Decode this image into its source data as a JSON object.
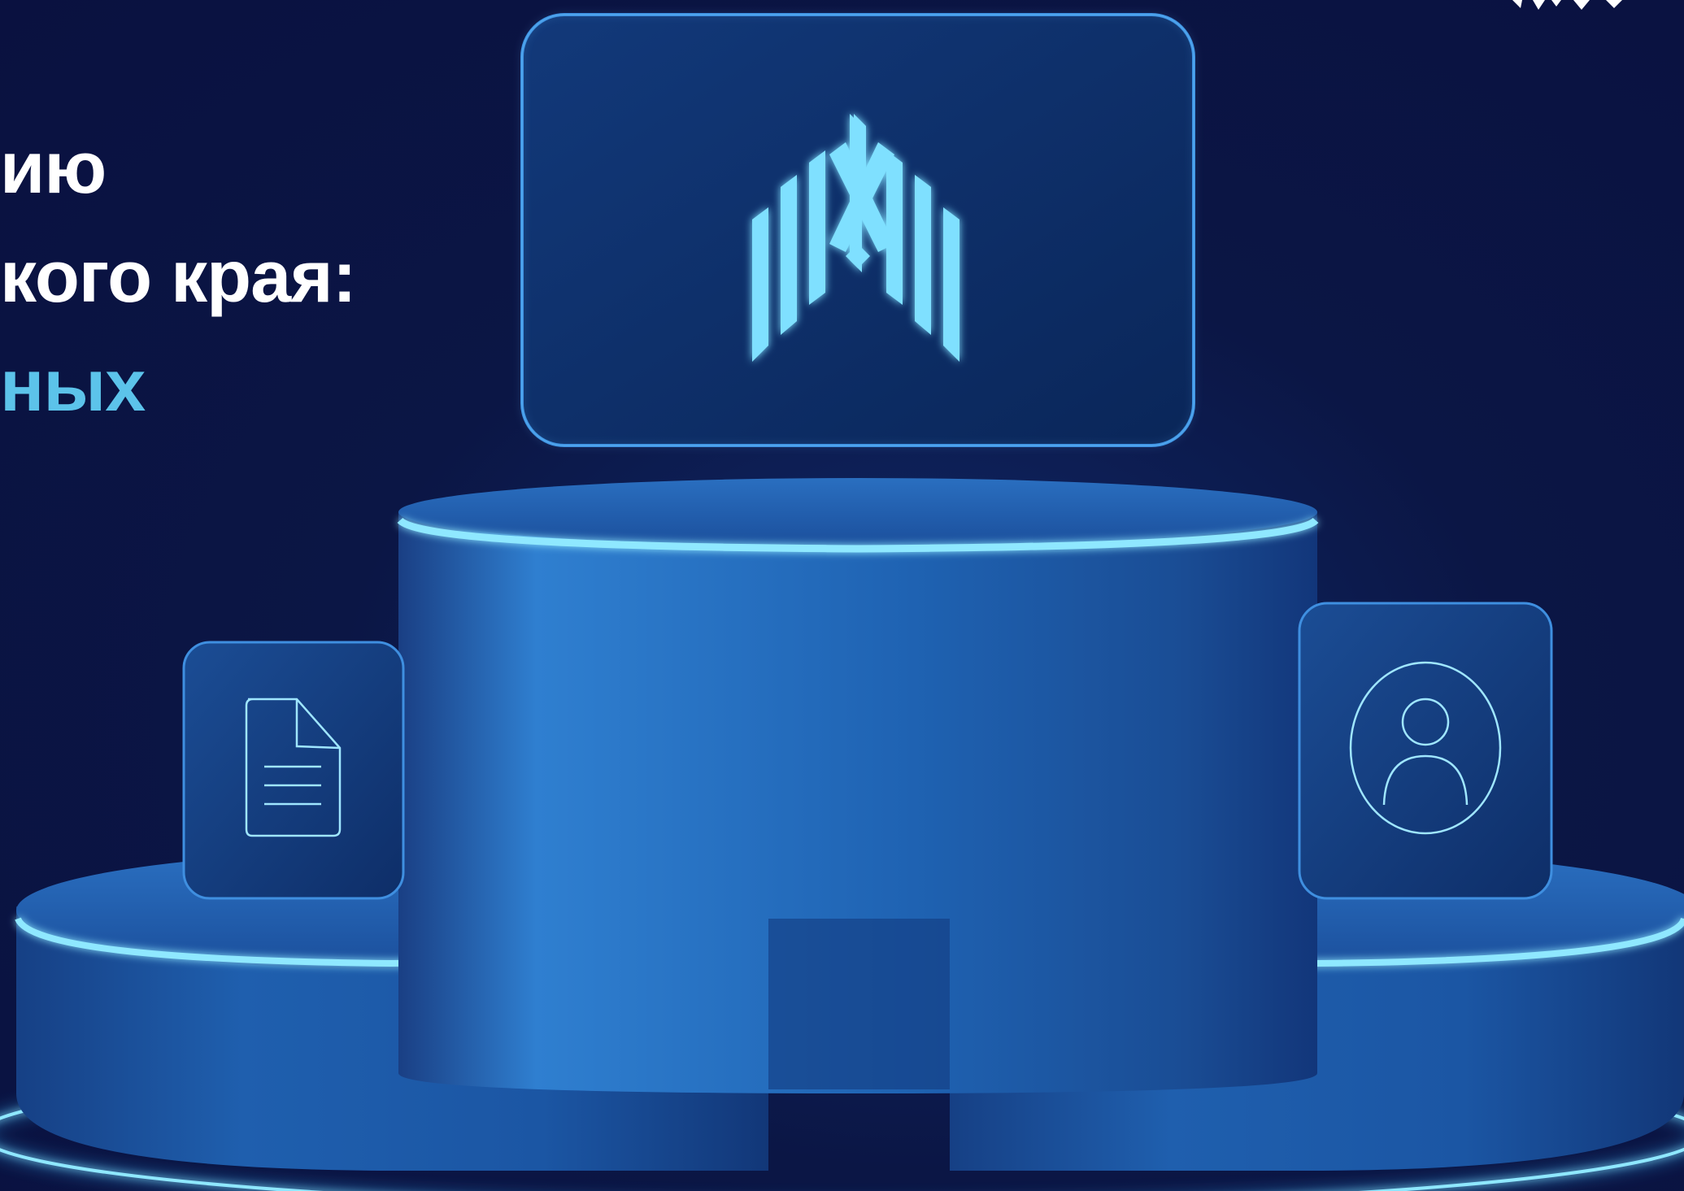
{
  "headline": {
    "lines": [
      {
        "text": "ию",
        "color": "#ffffff"
      },
      {
        "text": "кого края:",
        "color": "#ffffff"
      },
      {
        "text": "ных",
        "color": "#5cc3ea"
      }
    ]
  },
  "colors": {
    "background": "#0b1240",
    "podium": "#1d5ea8",
    "glow": "#7fe4ff",
    "card": "#0f3470",
    "logo": "#7fe0ff"
  },
  "icons": {
    "main_card": "abstract-logo-icon",
    "left_card": "document-icon",
    "right_card": "user-profile-icon",
    "corner": "corner-logo-icon"
  }
}
